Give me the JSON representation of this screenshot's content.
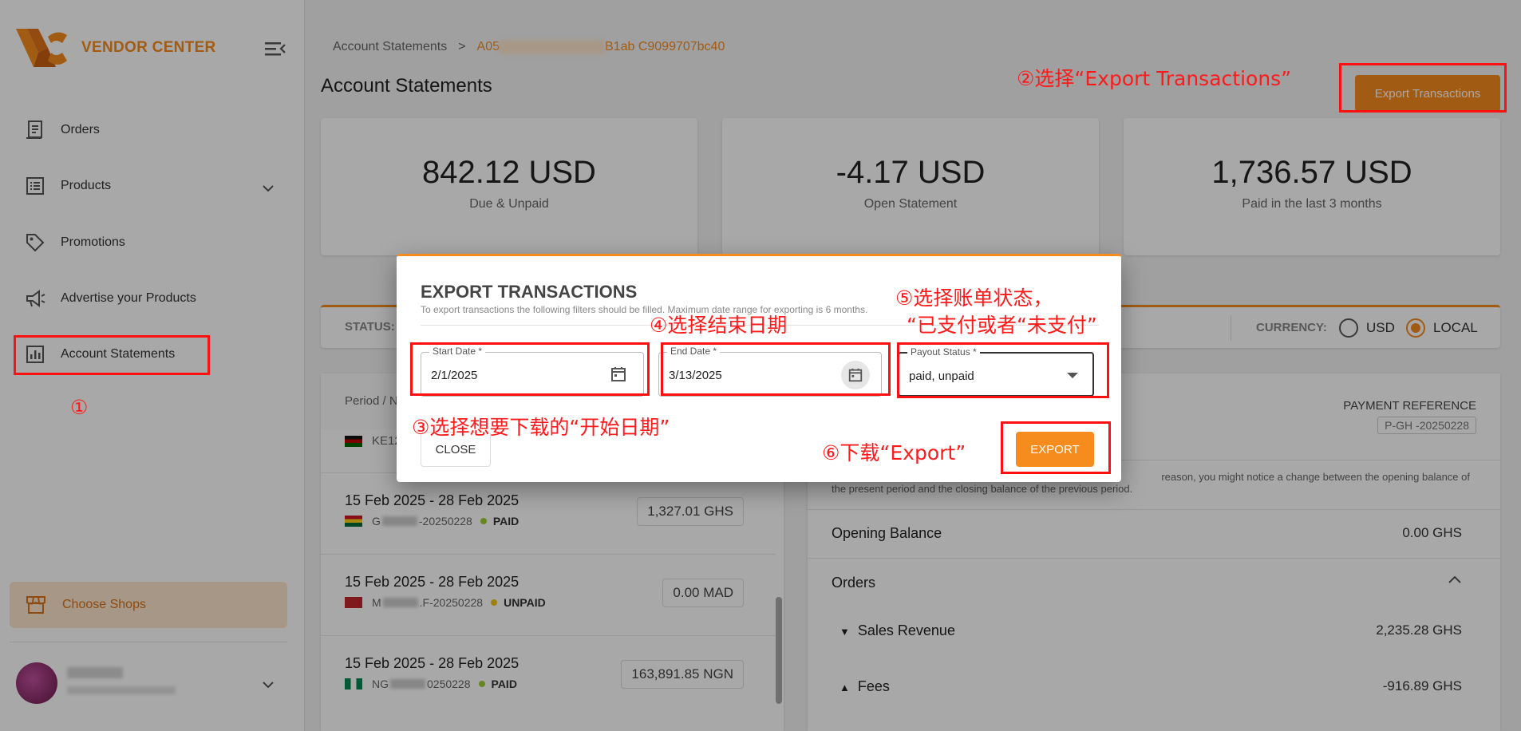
{
  "app": {
    "name": "VENDOR CENTER"
  },
  "sidebar": {
    "items": [
      {
        "label": "Orders",
        "icon": "receipt-icon"
      },
      {
        "label": "Products",
        "icon": "list-icon"
      },
      {
        "label": "Promotions",
        "icon": "tag-icon"
      },
      {
        "label": "Advertise your Products",
        "icon": "megaphone-icon"
      },
      {
        "label": "Account Statements",
        "icon": "bar-chart-icon"
      }
    ],
    "choose_shops": "Choose Shops"
  },
  "breadcrumb": {
    "root": "Account Statements",
    "separator": ">",
    "current_start": "A05",
    "current_end": "B1ab C9099707bc40"
  },
  "page": {
    "title": "Account Statements",
    "export_tx_button": "Export Transactions"
  },
  "stats": [
    {
      "value": "842.12 USD",
      "label": "Due & Unpaid"
    },
    {
      "value": "-4.17 USD",
      "label": "Open Statement"
    },
    {
      "value": "1,736.57 USD",
      "label": "Paid in the last 3 months"
    }
  ],
  "filter_bar": {
    "status_label": "STATUS:",
    "currency_label": "CURRENCY:",
    "currency_options": [
      "USD",
      "LOCAL"
    ],
    "currency_selected": "LOCAL"
  },
  "list": {
    "header": "Period / N",
    "partial_row": "KE12",
    "rows": [
      {
        "period": "15 Feb 2025 - 28 Feb 2025",
        "ref_prefix": "G",
        "ref_suffix": "-20250228",
        "status": "PAID",
        "amount": "1,327.01 GHS",
        "flag": "ghana"
      },
      {
        "period": "15 Feb 2025 - 28 Feb 2025",
        "ref_prefix": "M",
        "ref_suffix": ".F-20250228",
        "status": "UNPAID",
        "amount": "0.00 MAD",
        "flag": "morocco"
      },
      {
        "period": "15 Feb 2025 - 28 Feb 2025",
        "ref_prefix": "NG",
        "ref_suffix": "0250228",
        "status": "PAID",
        "amount": "163,891.85 NGN",
        "flag": "nigeria"
      }
    ]
  },
  "detail": {
    "payment_reference_label": "PAYMENT REFERENCE",
    "payment_reference_value": "P-GH         -20250228",
    "note_line1": "reason, you might notice a change between the opening balance of",
    "note_line2": "the present period and the closing balance of the previous period.",
    "opening_balance_label": "Opening Balance",
    "opening_balance_value": "0.00 GHS",
    "orders_label": "Orders",
    "sales_revenue_label": "Sales Revenue",
    "sales_revenue_value": "2,235.28 GHS",
    "fees_label": "Fees",
    "fees_value": "-916.89 GHS"
  },
  "modal": {
    "title": "EXPORT TRANSACTIONS",
    "description": "To export transactions the following filters should be filled. Maximum date range for exporting is 6 months.",
    "start_date_label": "Start Date *",
    "start_date_value": "2/1/2025",
    "end_date_label": "End Date *",
    "end_date_value": "3/13/2025",
    "payout_status_label": "Payout Status *",
    "payout_status_value": "paid, unpaid",
    "close_button": "CLOSE",
    "export_button": "EXPORT"
  },
  "annotations": {
    "step1": "①",
    "step2": "②选择“Export Transactions”",
    "step3": "③选择想要下载的“开始日期”",
    "step4": "④选择结束日期",
    "step5_line1": "⑤选择账单状态，",
    "step5_line2": "“已支付或者“未支付”",
    "step6": "⑥下载“Export”"
  },
  "colors": {
    "accent": "#f68b1e",
    "annotation": "#ff1010",
    "paid_dot": "#9ccc30"
  }
}
